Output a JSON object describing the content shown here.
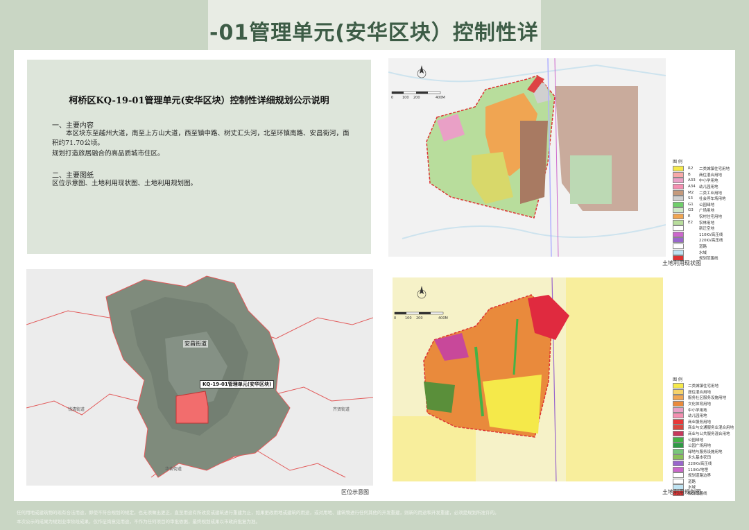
{
  "header": {
    "title": "-01管理单元(安华区块）控制性详"
  },
  "description": {
    "title": "柯桥区KQ-19-01管理单元(安华区块）控制性详细规划公示说明",
    "section1_heading": "一、主要内容",
    "section1_p1": "本区块东至越州大道，南至上方山大道，西至镇中路、树丈汇头河，北至环镇南路、安昌街河，面积约71.70公顷。",
    "section1_p2": "规划打造旅居融合的高品质城市住区。",
    "section2_heading": "二、主要图纸",
    "section2_p1": "区位示意图、土地利用现状图、土地利用规划图。"
  },
  "location_map": {
    "caption": "区位示意图",
    "unit_label": "KQ-19-01管理单元(安华区块)",
    "labels": [
      "安昌街道",
      "钱清街道",
      "齐贤街道",
      "华舍街道"
    ]
  },
  "current_map": {
    "caption": "土地利用现状图",
    "scale_labels": [
      "0",
      "100",
      "200",
      "400M"
    ],
    "legend_title": "图 例",
    "legend": [
      {
        "code": "R2",
        "name": "二类城镇住宅用地",
        "color": "#f5e94a"
      },
      {
        "code": "B",
        "name": "商住混合用地",
        "color": "#f7a9a8"
      },
      {
        "code": "A33",
        "name": "中小学用地",
        "color": "#e9a0c6"
      },
      {
        "code": "A34",
        "name": "幼儿园用地",
        "color": "#f48fb1"
      },
      {
        "code": "M2",
        "name": "二类工业用地",
        "color": "#c59a7c"
      },
      {
        "code": "S3",
        "name": "社会停车场用地",
        "color": "#d0d0d0"
      },
      {
        "code": "G1",
        "name": "公园绿地",
        "color": "#6fcf6a"
      },
      {
        "code": "G3",
        "name": "广场用地",
        "color": "#cfe8c6"
      },
      {
        "code": "E",
        "name": "农村住宅用地",
        "color": "#f0a552"
      },
      {
        "code": "E2",
        "name": "农林用地",
        "color": "#b8dd9c"
      },
      {
        "code": "",
        "name": "新迁空地",
        "color": "#ffffff"
      },
      {
        "code": "",
        "name": "110KV高压线",
        "color": "#cc66cc"
      },
      {
        "code": "",
        "name": "220KV高压线",
        "color": "#9966cc"
      },
      {
        "code": "",
        "name": "道路",
        "color": "#ffffff"
      },
      {
        "code": "",
        "name": "水域",
        "color": "#bfe3f2"
      },
      {
        "code": "",
        "name": "规划范围线",
        "color": "#dd3333"
      }
    ]
  },
  "plan_map": {
    "caption": "土地利用规划图",
    "scale_labels": [
      "0",
      "100",
      "200",
      "400M"
    ],
    "legend_title": "图 例",
    "legend": [
      {
        "name": "二类城镇住宅用地",
        "color": "#f5e94a"
      },
      {
        "name": "居住混合用地",
        "color": "#f6d36a"
      },
      {
        "name": "服务社区服务设施用地",
        "color": "#f0a552"
      },
      {
        "name": "文化体育用地",
        "color": "#e98a3c"
      },
      {
        "name": "中小学用地",
        "color": "#e9a0c6"
      },
      {
        "name": "幼儿园用地",
        "color": "#f48fb1"
      },
      {
        "name": "商业服务用地",
        "color": "#e83838"
      },
      {
        "name": "商业与交通服务业混合用地",
        "color": "#d9473f"
      },
      {
        "name": "商业与公共服务混合用地",
        "color": "#c7385c"
      },
      {
        "name": "公园绿地",
        "color": "#45b245"
      },
      {
        "name": "公园广场用地",
        "color": "#2e9a45"
      },
      {
        "name": "绿地与服务设施用地",
        "color": "#77c77a"
      },
      {
        "name": "永久基本农田",
        "color": "#8abf5a"
      },
      {
        "name": "220KV高压线",
        "color": "#9966cc"
      },
      {
        "name": "110KV地埋",
        "color": "#cc66cc"
      },
      {
        "name": "规划道路边界",
        "color": "#ffffff"
      },
      {
        "name": "道路",
        "color": "#ffffff"
      },
      {
        "name": "水域",
        "color": "#bfe3f2"
      },
      {
        "name": "规划范围线",
        "color": "#dd3333"
      }
    ]
  },
  "footer": {
    "line1": "任何用地或建筑物的现有合法用途，即使不符合规划的规定，也无须做出更正，直至用途有所改变或建筑进行重建为止，如果更改用地或建筑的用途，或对用地、建筑物进行任何其他的开发重建，则新的用途和开发重建，必须是规划所准许的。",
    "line2": "本次公示的成果为规划业审阶段成果，仅作征询意见用途，不作为任何项目的审批依据，最终规划成果以市政府批复为准。"
  }
}
